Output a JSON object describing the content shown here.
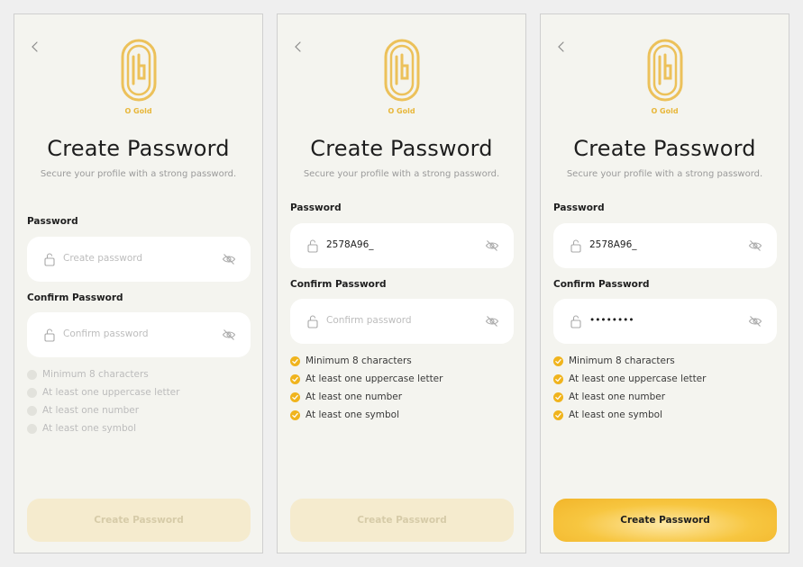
{
  "colors": {
    "gold": "#f0b41d",
    "cta_active": "#f7c640",
    "cta_disabled": "#f5ebce",
    "background": "#f4f4ef"
  },
  "screens": [
    {
      "brand": "O Gold",
      "title": "Create Password",
      "subtitle": "Secure your profile with a strong password.",
      "password_label": "Password",
      "password_value": "",
      "password_placeholder": "Create password",
      "confirm_label": "Confirm Password",
      "confirm_value": "",
      "confirm_placeholder": "Confirm password",
      "rules": [
        {
          "text": "Minimum 8 characters",
          "met": false
        },
        {
          "text": "At least one uppercase letter",
          "met": false
        },
        {
          "text": "At least one number",
          "met": false
        },
        {
          "text": "At least one symbol",
          "met": false
        }
      ],
      "button_label": "Create Password",
      "button_enabled": false
    },
    {
      "brand": "O Gold",
      "title": "Create Password",
      "subtitle": "Secure your profile with a strong password.",
      "password_label": "Password",
      "password_value": "2578A96_",
      "password_placeholder": "Create password",
      "confirm_label": "Confirm Password",
      "confirm_value": "",
      "confirm_placeholder": "Confirm password",
      "rules": [
        {
          "text": "Minimum 8 characters",
          "met": true
        },
        {
          "text": "At least one uppercase letter",
          "met": true
        },
        {
          "text": "At least one number",
          "met": true
        },
        {
          "text": "At least one symbol",
          "met": true
        }
      ],
      "button_label": "Create Password",
      "button_enabled": false
    },
    {
      "brand": "O Gold",
      "title": "Create Password",
      "subtitle": "Secure your profile with a strong password.",
      "password_label": "Password",
      "password_value": "2578A96_",
      "password_placeholder": "Create password",
      "confirm_label": "Confirm Password",
      "confirm_value": "••••••••",
      "confirm_placeholder": "Confirm password",
      "rules": [
        {
          "text": "Minimum 8 characters",
          "met": true
        },
        {
          "text": "At least one uppercase letter",
          "met": true
        },
        {
          "text": "At least one number",
          "met": true
        },
        {
          "text": "At least one symbol",
          "met": true
        }
      ],
      "button_label": "Create Password",
      "button_enabled": true
    }
  ]
}
